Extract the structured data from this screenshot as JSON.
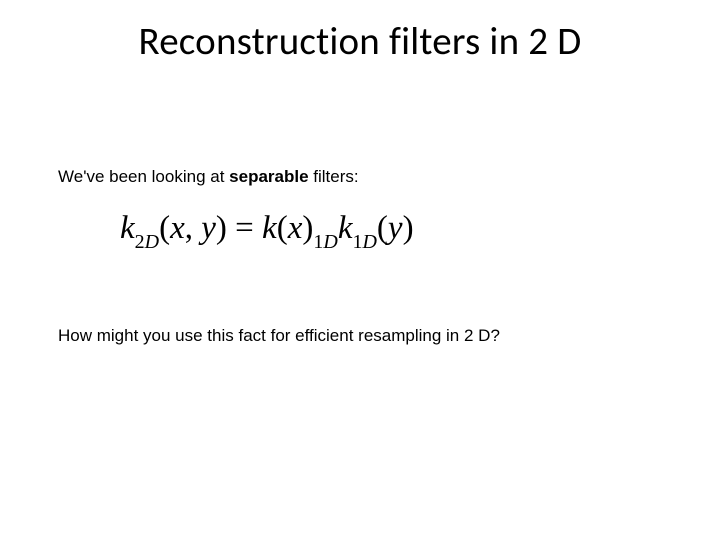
{
  "title": "Reconstruction filters in 2 D",
  "line1_prefix": "We've been looking at ",
  "line1_bold": "separable",
  "line1_suffix": " filters:",
  "line2": "How might you use this fact for efficient resampling in 2 D?",
  "equation": {
    "lhs_k": "k",
    "lhs_sub": "2",
    "lhs_subD": "D",
    "args_xy_open": "(",
    "arg_x": "x",
    "comma": ",",
    "space": " ",
    "arg_y": "y",
    "args_close": ")",
    "equals": " = ",
    "r1_k": "k",
    "r1_open": "(",
    "r1_x": "x",
    "r1_close": ")",
    "r1_sub1": "1",
    "r1_subD": "D",
    "r2_k": "k",
    "r2_sub1": "1",
    "r2_subD": "D",
    "r2_open": "(",
    "r2_y": "y",
    "r2_close": ")"
  }
}
